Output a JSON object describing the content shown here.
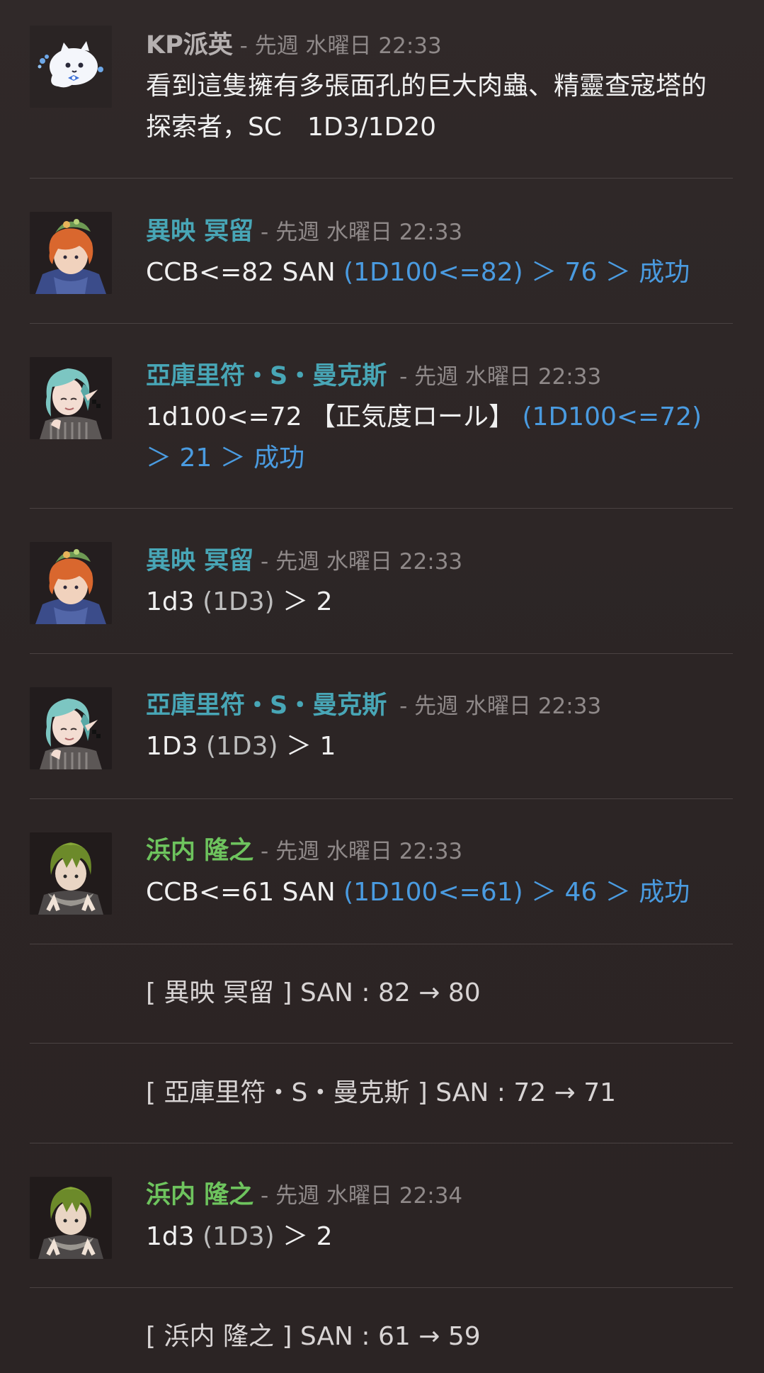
{
  "colors": {
    "background": "#2d2626",
    "divider": "#4a4242",
    "kp_name": "#b5b0b0",
    "teal_name": "#48a6b6",
    "green_name": "#6ec45e",
    "timestamp": "#8f8989",
    "roll_result": "#4a9be0"
  },
  "messages": [
    {
      "name": "KP派英",
      "separator": " - ",
      "time": "先週 水曜日 22:33",
      "avatar_icon": "ghost-cat-avatar-icon",
      "body_plain": "看到這隻擁有多張面孔的巨大肉蟲、精靈查寇塔的探索者，SC　1D3/1D20"
    },
    {
      "name": "異映 冥留",
      "separator": " - ",
      "time": "先週 水曜日 22:33",
      "avatar_icon": "orange-hair-character-avatar-icon",
      "body_prefix": "CCB<=82 SAN ",
      "body_result": "(1D100<=82) ＞ 76 ＞ 成功"
    },
    {
      "name": "亞庫里符・S・曼克斯",
      "separator": " - ",
      "time": "先週 水曜日 22:33",
      "avatar_icon": "teal-hair-character-avatar-icon",
      "body_prefix": "1d100<=72 【正気度ロール】 ",
      "body_result": "(1D100<=72) ＞ 21 ＞ 成功"
    },
    {
      "name": "異映 冥留",
      "separator": " - ",
      "time": "先週 水曜日 22:33",
      "avatar_icon": "orange-hair-character-avatar-icon",
      "body_prefix": "1d3 ",
      "body_paren": "(1D3)",
      "body_suffix": " ＞ 2"
    },
    {
      "name": "亞庫里符・S・曼克斯",
      "separator": " - ",
      "time": "先週 水曜日 22:33",
      "avatar_icon": "teal-hair-character-avatar-icon",
      "body_prefix": "1D3 ",
      "body_paren": "(1D3)",
      "body_suffix": " ＞ 1"
    },
    {
      "name": "浜内 隆之",
      "separator": " - ",
      "time": "先週 水曜日 22:33",
      "avatar_icon": "green-hair-character-avatar-icon",
      "body_prefix": "CCB<=61 SAN ",
      "body_result": "(1D100<=61) ＞ 46 ＞ 成功"
    },
    {
      "system": "[ 異映 冥留 ] SAN : 82 → 80"
    },
    {
      "system": "[ 亞庫里符・S・曼克斯 ] SAN : 72 → 71"
    },
    {
      "name": "浜内 隆之",
      "separator": " - ",
      "time": "先週 水曜日 22:34",
      "avatar_icon": "green-hair-character-avatar-icon",
      "body_prefix": "1d3 ",
      "body_paren": "(1D3)",
      "body_suffix": " ＞ 2"
    },
    {
      "system": "[ 浜内 隆之 ] SAN : 61 → 59"
    }
  ]
}
